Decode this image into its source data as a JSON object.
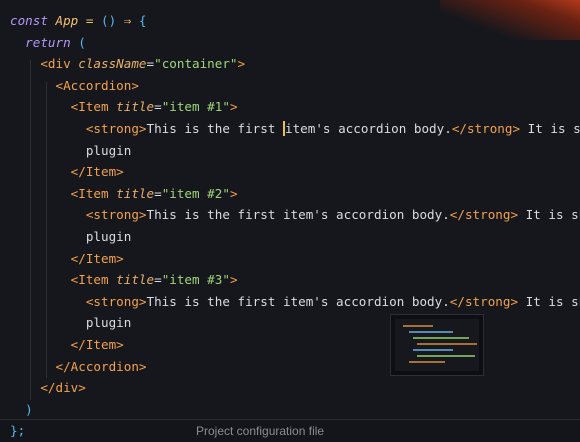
{
  "code_lines": [
    {
      "tokens": [
        {
          "t": "const ",
          "c": "kw"
        },
        {
          "t": "App",
          "c": "id"
        },
        {
          "t": " = ",
          "c": "op"
        },
        {
          "t": "() ",
          "c": "pun"
        },
        {
          "t": "⇒",
          "c": "op"
        },
        {
          "t": " {",
          "c": "pun"
        }
      ]
    },
    {
      "tokens": [
        {
          "t": "  return ",
          "c": "kw"
        },
        {
          "t": "(",
          "c": "pun"
        }
      ]
    },
    {
      "tokens": [
        {
          "t": "    ",
          "c": "txt"
        },
        {
          "t": "<div ",
          "c": "tag"
        },
        {
          "t": "className",
          "c": "attr"
        },
        {
          "t": "=",
          "c": "txt"
        },
        {
          "t": "\"container\"",
          "c": "str"
        },
        {
          "t": ">",
          "c": "tag"
        }
      ]
    },
    {
      "tokens": [
        {
          "t": "      ",
          "c": "txt"
        },
        {
          "t": "<Accordion>",
          "c": "tag"
        }
      ]
    },
    {
      "tokens": [
        {
          "t": "        ",
          "c": "txt"
        },
        {
          "t": "<Item ",
          "c": "tag"
        },
        {
          "t": "title",
          "c": "attr"
        },
        {
          "t": "=",
          "c": "txt"
        },
        {
          "t": "\"item #1\"",
          "c": "str"
        },
        {
          "t": ">",
          "c": "tag"
        }
      ]
    },
    {
      "tokens": [
        {
          "t": "          ",
          "c": "txt"
        },
        {
          "t": "<strong>",
          "c": "tag"
        },
        {
          "t": "This is the first ",
          "c": "txt"
        },
        {
          "t": "i",
          "c": "txt",
          "cursor": true
        },
        {
          "t": "tem's accordion body.",
          "c": "txt"
        },
        {
          "t": "</strong>",
          "c": "tag"
        },
        {
          "t": " It is shown b",
          "c": "txt"
        }
      ]
    },
    {
      "tokens": [
        {
          "t": "          plugin",
          "c": "txt"
        }
      ]
    },
    {
      "tokens": [
        {
          "t": "        ",
          "c": "txt"
        },
        {
          "t": "</Item>",
          "c": "tag"
        }
      ]
    },
    {
      "tokens": [
        {
          "t": "        ",
          "c": "txt"
        },
        {
          "t": "<Item ",
          "c": "tag"
        },
        {
          "t": "title",
          "c": "attr"
        },
        {
          "t": "=",
          "c": "txt"
        },
        {
          "t": "\"item #2\"",
          "c": "str"
        },
        {
          "t": ">",
          "c": "tag"
        }
      ]
    },
    {
      "tokens": [
        {
          "t": "          ",
          "c": "txt"
        },
        {
          "t": "<strong>",
          "c": "tag"
        },
        {
          "t": "This is the first item's accordion body.",
          "c": "txt"
        },
        {
          "t": "</strong>",
          "c": "tag"
        },
        {
          "t": " It is shown b",
          "c": "txt"
        }
      ]
    },
    {
      "tokens": [
        {
          "t": "          plugin",
          "c": "txt"
        }
      ]
    },
    {
      "tokens": [
        {
          "t": "        ",
          "c": "txt"
        },
        {
          "t": "</Item>",
          "c": "tag"
        }
      ]
    },
    {
      "tokens": [
        {
          "t": "        ",
          "c": "txt"
        },
        {
          "t": "<Item ",
          "c": "tag"
        },
        {
          "t": "title",
          "c": "attr"
        },
        {
          "t": "=",
          "c": "txt"
        },
        {
          "t": "\"item #3\"",
          "c": "str"
        },
        {
          "t": ">",
          "c": "tag"
        }
      ]
    },
    {
      "tokens": [
        {
          "t": "          ",
          "c": "txt"
        },
        {
          "t": "<strong>",
          "c": "tag"
        },
        {
          "t": "This is the first item's accordion body.",
          "c": "txt"
        },
        {
          "t": "</strong>",
          "c": "tag"
        },
        {
          "t": " It is shown b",
          "c": "txt"
        }
      ]
    },
    {
      "tokens": [
        {
          "t": "          plugin",
          "c": "txt"
        }
      ]
    },
    {
      "tokens": [
        {
          "t": "        ",
          "c": "txt"
        },
        {
          "t": "</Item>",
          "c": "tag"
        }
      ]
    },
    {
      "tokens": [
        {
          "t": "      ",
          "c": "txt"
        },
        {
          "t": "</Accordion>",
          "c": "tag"
        }
      ]
    },
    {
      "tokens": [
        {
          "t": "    ",
          "c": "txt"
        },
        {
          "t": "</div>",
          "c": "tag"
        }
      ]
    },
    {
      "tokens": [
        {
          "t": "  )",
          "c": "pun"
        }
      ]
    }
  ],
  "bottom_bar": {
    "last_line": "};",
    "caption": "Project configuration file"
  },
  "colors": {
    "background": "#16171c",
    "keyword": "#b496f8",
    "tag": "#f2a14c",
    "string": "#9fd57a",
    "punctuation": "#56b6e8"
  }
}
